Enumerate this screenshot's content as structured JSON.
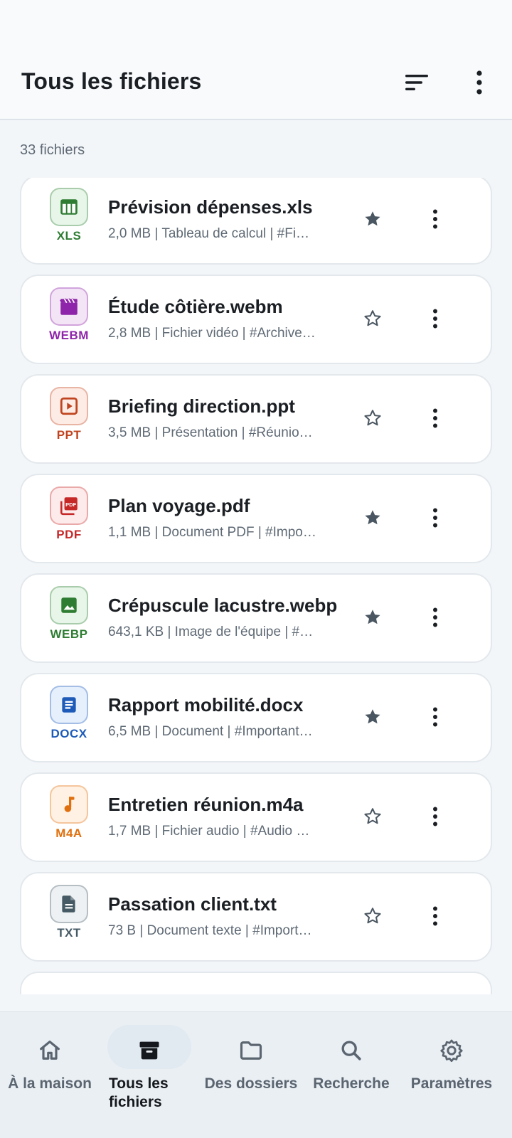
{
  "header": {
    "title": "Tous les fichiers",
    "sort_icon": "sort-icon",
    "more_icon": "more-vertical-icon"
  },
  "file_count": "33 fichiers",
  "files": [
    {
      "name": "Prévision dépenses.xls",
      "meta": "2,0 MB | Tableau de calcul | #Fi…",
      "type": "XLS",
      "icon": "table-icon",
      "color": "#2e7d32",
      "bg": "#e8f5e9",
      "starred": true
    },
    {
      "name": "Étude côtière.webm",
      "meta": "2,8 MB | Fichier vidéo | #Archive…",
      "type": "WEBM",
      "icon": "video-clapper-icon",
      "color": "#8e24aa",
      "bg": "#f3e5f5",
      "starred": false
    },
    {
      "name": "Briefing direction.ppt",
      "meta": "3,5 MB | Présentation | #Réunio…",
      "type": "PPT",
      "icon": "presentation-icon",
      "color": "#c0441f",
      "bg": "#fdece6",
      "starred": false
    },
    {
      "name": "Plan voyage.pdf",
      "meta": "1,1 MB | Document PDF | #Impo…",
      "type": "PDF",
      "icon": "pdf-icon",
      "color": "#c62828",
      "bg": "#fdeaea",
      "starred": true
    },
    {
      "name": "Crépuscule lacustre.webp",
      "meta": "643,1 KB | Image de l'équipe | #…",
      "type": "WEBP",
      "icon": "image-icon",
      "color": "#2e7d32",
      "bg": "#e8f5e9",
      "starred": true
    },
    {
      "name": "Rapport mobilité.docx",
      "meta": "6,5 MB | Document | #Important…",
      "type": "DOCX",
      "icon": "document-icon",
      "color": "#1e5bb8",
      "bg": "#e6effc",
      "starred": true
    },
    {
      "name": "Entretien réunion.m4a",
      "meta": "1,7 MB | Fichier audio | #Audio  …",
      "type": "M4A",
      "icon": "music-note-icon",
      "color": "#e0700f",
      "bg": "#fff1e3",
      "starred": false
    },
    {
      "name": "Passation client.txt",
      "meta": "73 B | Document texte | #Import…",
      "type": "TXT",
      "icon": "text-file-icon",
      "color": "#455a64",
      "bg": "#eef1f3",
      "starred": false
    }
  ],
  "nav": [
    {
      "label": "À la maison",
      "icon": "home-icon",
      "active": false
    },
    {
      "label": "Tous les fichiers",
      "icon": "archive-box-icon",
      "active": true
    },
    {
      "label": "Des dossiers",
      "icon": "folder-icon",
      "active": false
    },
    {
      "label": "Recherche",
      "icon": "search-icon",
      "active": false
    },
    {
      "label": "Paramètres",
      "icon": "gear-icon",
      "active": false
    }
  ],
  "colors": {
    "star_filled": "#4a5661",
    "star_outline": "#4a5661",
    "nav_active_pill": "#e1eaf1"
  }
}
